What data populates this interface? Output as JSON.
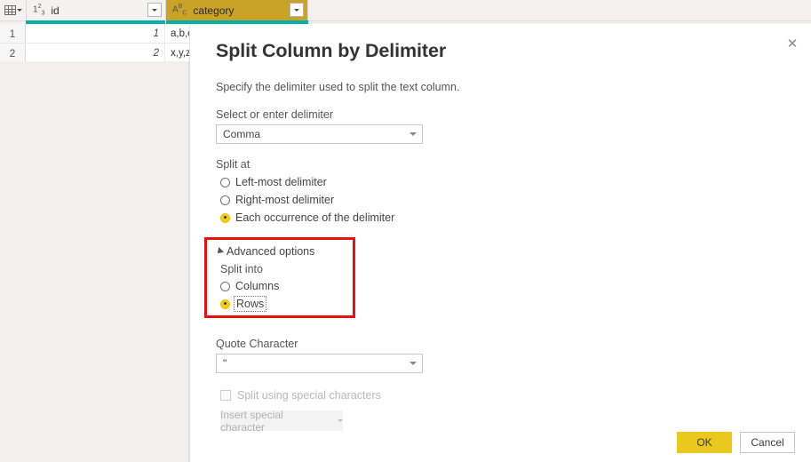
{
  "grid": {
    "corner_icon": "table-corner-icon",
    "columns": [
      {
        "name": "id",
        "type_icon": "123",
        "type_kind": "whole-number"
      },
      {
        "name": "category",
        "type_icon": "ABC",
        "type_kind": "text"
      }
    ],
    "rows": [
      {
        "num": "1",
        "id": "1",
        "category": "a,b,c"
      },
      {
        "num": "2",
        "id": "2",
        "category": "x,y,z"
      }
    ],
    "colors": {
      "selected_column": "#c9a227",
      "quality_bar": "#00b0a8",
      "pane_background": "#f1f0ee"
    }
  },
  "dialog": {
    "title": "Split Column by Delimiter",
    "subtitle": "Specify the delimiter used to split the text column.",
    "close_label": "✕",
    "delimiter": {
      "label": "Select or enter delimiter",
      "value": "Comma"
    },
    "split_at": {
      "label": "Split at",
      "options": [
        {
          "label": "Left-most delimiter",
          "selected": false
        },
        {
          "label": "Right-most delimiter",
          "selected": false
        },
        {
          "label": "Each occurrence of the delimiter",
          "selected": true
        }
      ]
    },
    "advanced": {
      "toggle_label": "Advanced options",
      "expanded": true,
      "split_into": {
        "label": "Split into",
        "options": [
          {
            "label": "Columns",
            "selected": false
          },
          {
            "label": "Rows",
            "selected": true,
            "focused": true
          }
        ]
      },
      "highlight_color": "#e8110f"
    },
    "quote_character": {
      "label": "Quote Character",
      "value": "\""
    },
    "special_characters": {
      "checkbox_label": "Split using special characters",
      "checked": false,
      "enabled": false,
      "insert_button_label": "Insert special character",
      "insert_button_enabled": false
    },
    "footer": {
      "ok_label": "OK",
      "cancel_label": "Cancel",
      "ok_color": "#ebc81e"
    }
  }
}
